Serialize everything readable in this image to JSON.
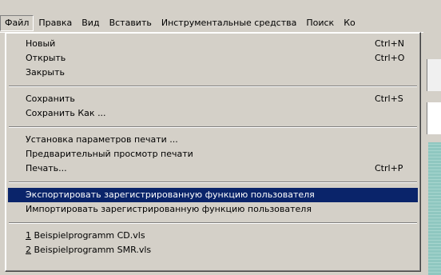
{
  "menubar": {
    "items": [
      "Файл",
      "Правка",
      "Вид",
      "Вставить",
      "Инструментальные средства",
      "Поиск",
      "Ко"
    ]
  },
  "file_menu": {
    "groups": [
      [
        {
          "label": "Новый",
          "shortcut": "Ctrl+N"
        },
        {
          "label": "Открыть",
          "shortcut": "Ctrl+O"
        },
        {
          "label": "Закрыть",
          "shortcut": ""
        }
      ],
      [
        {
          "label": "Сохранить",
          "shortcut": "Ctrl+S"
        },
        {
          "label": "Сохранить Как ...",
          "shortcut": ""
        }
      ],
      [
        {
          "label": "Установка параметров печати ...",
          "shortcut": ""
        },
        {
          "label": "Предварительный просмотр печати",
          "shortcut": ""
        },
        {
          "label": "Печать...",
          "shortcut": "Ctrl+P"
        }
      ],
      [
        {
          "label": "Экспортировать зарегистрированную функцию пользователя",
          "shortcut": ""
        },
        {
          "label": "Импортировать зарегистрированную функцию пользователя",
          "shortcut": ""
        }
      ]
    ],
    "recent": [
      {
        "num": "1",
        "name": " Beispielprogramm CD.vls"
      },
      {
        "num": "2",
        "name": " Beispielprogramm SMR.vls"
      }
    ],
    "highlighted": "Экспортировать зарегистрированную функцию пользователя"
  },
  "colors": {
    "highlight": "#0a246a",
    "face": "#d4d0c8"
  }
}
